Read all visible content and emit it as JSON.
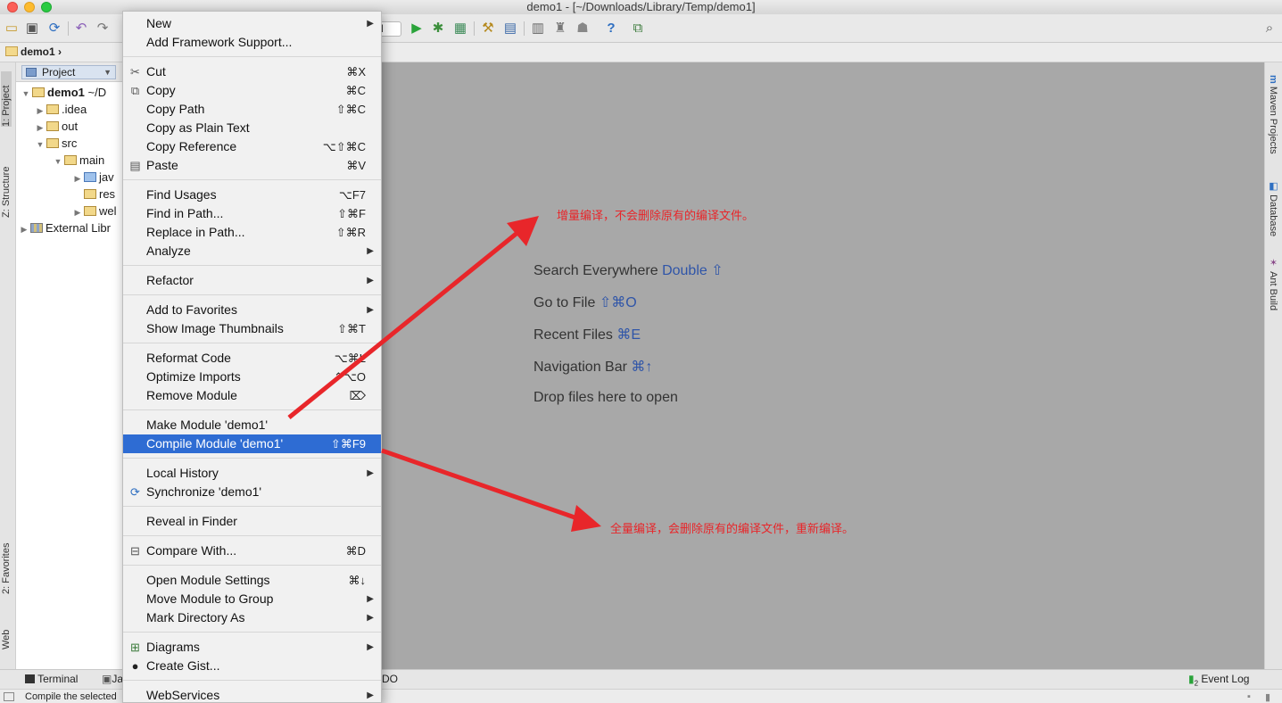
{
  "window": {
    "title": "demo1 - [~/Downloads/Library/Temp/demo1]"
  },
  "toolbar": {
    "icons": [
      "folder-open-icon",
      "save-icon",
      "sync-icon",
      "undo-icon",
      "redo-icon",
      "run-icon",
      "debug-icon",
      "coverage-icon",
      "project-structure-icon",
      "sdk-icon",
      "help-icon"
    ],
    "run_config_value": "d"
  },
  "navbar": {
    "breadcrumb": "demo1"
  },
  "left_stripe": {
    "tabs": [
      "1: Project",
      "Z: Structure",
      "2: Favorites",
      "Web"
    ]
  },
  "project_panel": {
    "view_selector": "Project",
    "tree": [
      {
        "label": "demo1",
        "extra": "~/D",
        "bold": true,
        "expanded": true,
        "depth": 0
      },
      {
        "label": ".idea",
        "expanded": false,
        "depth": 1
      },
      {
        "label": "out",
        "expanded": false,
        "depth": 1
      },
      {
        "label": "src",
        "expanded": true,
        "depth": 1
      },
      {
        "label": "main",
        "expanded": true,
        "depth": 2
      },
      {
        "label": "jav",
        "expanded": false,
        "depth": 3
      },
      {
        "label": "res",
        "depth": 3
      },
      {
        "label": "wel",
        "expanded": false,
        "depth": 3
      },
      {
        "label": "External Libr",
        "expanded": false,
        "depth": 0
      }
    ]
  },
  "context_menu": {
    "items": [
      {
        "label": "New",
        "submenu": true
      },
      {
        "label": "Add Framework Support..."
      },
      {
        "label": "Cut",
        "shortcut": "⌘X",
        "icon": "scissors-icon"
      },
      {
        "label": "Copy",
        "shortcut": "⌘C",
        "icon": "copy-icon"
      },
      {
        "label": "Copy Path",
        "shortcut": "⇧⌘C"
      },
      {
        "label": "Copy as Plain Text"
      },
      {
        "label": "Copy Reference",
        "shortcut": "⌥⇧⌘C"
      },
      {
        "label": "Paste",
        "shortcut": "⌘V",
        "icon": "paste-icon"
      },
      {
        "label": "Find Usages",
        "shortcut": "⌥F7"
      },
      {
        "label": "Find in Path...",
        "shortcut": "⇧⌘F"
      },
      {
        "label": "Replace in Path...",
        "shortcut": "⇧⌘R"
      },
      {
        "label": "Analyze",
        "submenu": true
      },
      {
        "label": "Refactor",
        "submenu": true
      },
      {
        "label": "Add to Favorites",
        "submenu": true
      },
      {
        "label": "Show Image Thumbnails",
        "shortcut": "⇧⌘T"
      },
      {
        "label": "Reformat Code",
        "shortcut": "⌥⌘L"
      },
      {
        "label": "Optimize Imports",
        "shortcut": "⌃⌥O"
      },
      {
        "label": "Remove Module",
        "shortcut": "⌦"
      },
      {
        "label": "Make Module 'demo1'"
      },
      {
        "label": "Compile Module 'demo1'",
        "shortcut": "⇧⌘F9",
        "selected": true
      },
      {
        "label": "Local History",
        "submenu": true
      },
      {
        "label": "Synchronize 'demo1'",
        "icon": "sync-icon"
      },
      {
        "label": "Reveal in Finder"
      },
      {
        "label": "Compare With...",
        "shortcut": "⌘D",
        "icon": "compare-icon"
      },
      {
        "label": "Open Module Settings",
        "shortcut": "⌘↓"
      },
      {
        "label": "Move Module to Group",
        "submenu": true
      },
      {
        "label": "Mark Directory As",
        "submenu": true
      },
      {
        "label": "Diagrams",
        "submenu": true,
        "icon": "diagram-icon"
      },
      {
        "label": "Create Gist...",
        "icon": "github-icon"
      },
      {
        "label": "WebServices",
        "submenu": true
      }
    ]
  },
  "editor": {
    "hints": [
      {
        "text": "Search Everywhere",
        "key": "Double ⇧"
      },
      {
        "text": "Go to File",
        "key": "⇧⌘O"
      },
      {
        "text": "Recent Files",
        "key": "⌘E"
      },
      {
        "text": "Navigation Bar",
        "key": "⌘↑"
      },
      {
        "text": "Drop files here to open",
        "key": ""
      }
    ]
  },
  "right_stripe": {
    "tabs": [
      "Maven Projects",
      "Database",
      "Ant Build"
    ]
  },
  "bottom_bar": {
    "terminal": "Terminal",
    "java_partial": "Ja",
    "todo_partial": "DO",
    "event_log": "Event Log"
  },
  "status_bar": {
    "text": "Compile the selected"
  },
  "annotations": {
    "incremental": "增量编译，不会删除原有的编译文件。",
    "full": "全量编译，会删除原有的编译文件，重新编译。",
    "color": "#e8262a"
  }
}
